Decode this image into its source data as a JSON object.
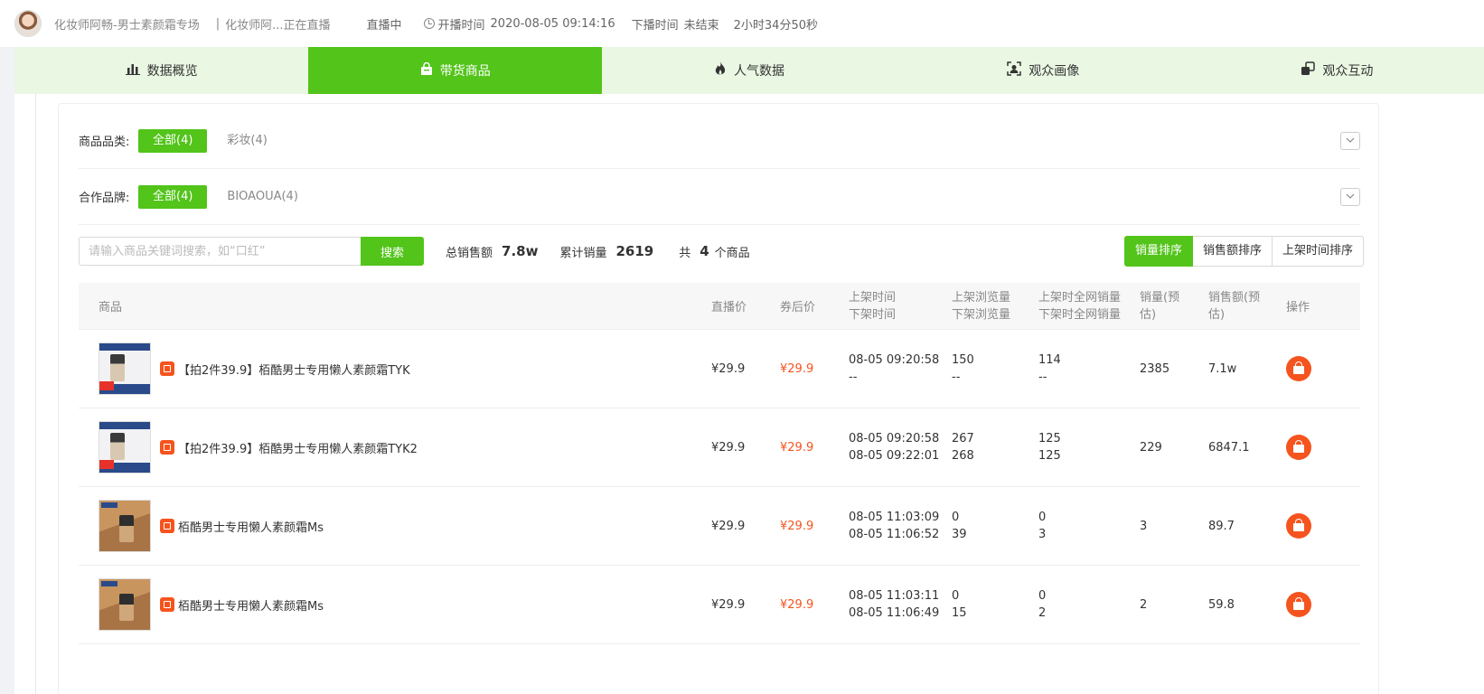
{
  "header": {
    "anchor_name": "化妆师阿畅-男士素颜霜专场",
    "separator": "|",
    "room_title": "化妆师阿...正在直播",
    "live_status": "直播中",
    "start_label": "开播时间",
    "start_time": "2020-08-05 09:14:16",
    "end_label": "下播时间",
    "end_value": "未结束",
    "duration": "2小时34分50秒"
  },
  "tabs": [
    {
      "label": "数据概览",
      "icon": "bar-chart-icon",
      "active": false
    },
    {
      "label": "带货商品",
      "icon": "shopping-bag-icon",
      "active": true
    },
    {
      "label": "人气数据",
      "icon": "fire-icon",
      "active": false
    },
    {
      "label": "观众画像",
      "icon": "user-portrait-icon",
      "active": false
    },
    {
      "label": "观众互动",
      "icon": "interaction-icon",
      "active": false
    }
  ],
  "filters": {
    "category": {
      "label": "商品品类:",
      "options": [
        "全部(4)",
        "彩妆(4)"
      ],
      "active_index": 0
    },
    "brand": {
      "label": "合作品牌:",
      "options": [
        "全部(4)",
        "BIOAOUA(4)"
      ],
      "active_index": 0
    }
  },
  "search": {
    "placeholder": "请输入商品关键词搜索，如“口红”",
    "button_label": "搜索"
  },
  "stats": {
    "total_sales_label": "总销售额",
    "total_sales_value": "7.8w",
    "cumulative_volume_label": "累计销量",
    "cumulative_volume_value": "2619",
    "count_prefix": "共",
    "count_value": "4",
    "count_suffix": "个商品"
  },
  "sort": {
    "options": [
      "销量排序",
      "销售额排序",
      "上架时间排序"
    ],
    "active_index": 0
  },
  "table": {
    "headers": {
      "product": "商品",
      "live_price": "直播价",
      "coupon_price": "券后价",
      "time_1": "上架时间",
      "time_2": "下架时间",
      "views_1": "上架浏览量",
      "views_2": "下架浏览量",
      "net_1": "上架时全网销量",
      "net_2": "下架时全网销量",
      "sales_1": "销量(预",
      "sales_2": "估)",
      "amount_1": "销售额(预",
      "amount_2": "估)",
      "op": "操作"
    },
    "rows": [
      {
        "thumb": "blue",
        "name": "【拍2件39.9】栢酷男士专用懒人素颜霜TYK",
        "live_price": "¥29.9",
        "coupon_price": "¥29.9",
        "on_time": "08-05 09:20:58",
        "off_time": "--",
        "on_views": "150",
        "off_views": "--",
        "on_net": "114",
        "off_net": "--",
        "sales": "2385",
        "amount": "7.1w"
      },
      {
        "thumb": "blue",
        "name": "【拍2件39.9】栢酷男士专用懒人素颜霜TYK2",
        "live_price": "¥29.9",
        "coupon_price": "¥29.9",
        "on_time": "08-05 09:20:58",
        "off_time": "08-05 09:22:01",
        "on_views": "267",
        "off_views": "268",
        "on_net": "125",
        "off_net": "125",
        "sales": "229",
        "amount": "6847.1"
      },
      {
        "thumb": "brown",
        "name": "栢酷男士专用懒人素颜霜Ms",
        "live_price": "¥29.9",
        "coupon_price": "¥29.9",
        "on_time": "08-05 11:03:09",
        "off_time": "08-05 11:06:52",
        "on_views": "0",
        "off_views": "39",
        "on_net": "0",
        "off_net": "3",
        "sales": "3",
        "amount": "89.7"
      },
      {
        "thumb": "brown",
        "name": "栢酷男士专用懒人素颜霜Ms",
        "live_price": "¥29.9",
        "coupon_price": "¥29.9",
        "on_time": "08-05 11:03:11",
        "off_time": "08-05 11:06:49",
        "on_views": "0",
        "off_views": "15",
        "on_net": "0",
        "off_net": "2",
        "sales": "2",
        "amount": "59.8"
      }
    ]
  },
  "colors": {
    "accent": "#52c41a",
    "tab_bg": "#e9f7e3",
    "price_highlight": "#f5541e"
  }
}
